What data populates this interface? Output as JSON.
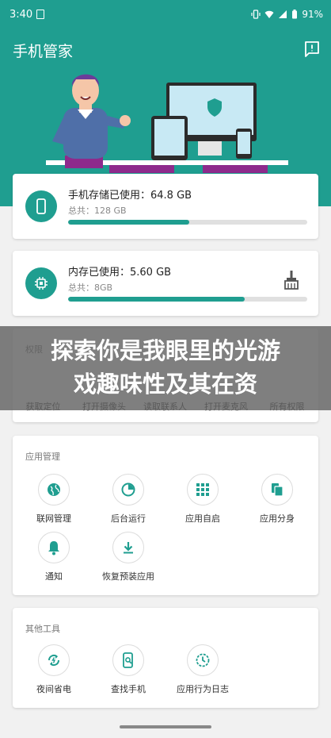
{
  "status_bar": {
    "time": "3:40",
    "battery": "91%"
  },
  "header": {
    "title": "手机管家"
  },
  "storage": {
    "title": "手机存储已使用：64.8 GB",
    "total": "总共：128 GB",
    "usage_fraction": 0.506
  },
  "memory": {
    "title": "内存已使用：5.60 GB",
    "total": "总共：8GB",
    "usage_fraction": 0.74
  },
  "permissions": {
    "section_title": "权限",
    "items": [
      "获取定位",
      "打开摄像头",
      "读取联系人",
      "打开麦克风",
      "所有权限"
    ]
  },
  "overlay": {
    "text": "探索你是我眼里的光游戏趣味性及其在资"
  },
  "app_management": {
    "section_title": "应用管理",
    "items": [
      {
        "label": "联网管理",
        "icon": "globe-icon"
      },
      {
        "label": "后台运行",
        "icon": "pie-chart-icon"
      },
      {
        "label": "应用自启",
        "icon": "grid-icon"
      },
      {
        "label": "应用分身",
        "icon": "copy-icon"
      },
      {
        "label": "通知",
        "icon": "bell-icon"
      },
      {
        "label": "恢复预装应用",
        "icon": "download-icon"
      }
    ]
  },
  "other_tools": {
    "section_title": "其他工具",
    "items": [
      {
        "label": "夜间省电",
        "icon": "battery-saver-icon"
      },
      {
        "label": "查找手机",
        "icon": "find-phone-icon"
      },
      {
        "label": "应用行为日志",
        "icon": "log-clock-icon"
      }
    ]
  },
  "colors": {
    "accent": "#1f9e90",
    "background": "#f1f1f1",
    "card": "#ffffff",
    "overlay": "#5f5f5f"
  }
}
